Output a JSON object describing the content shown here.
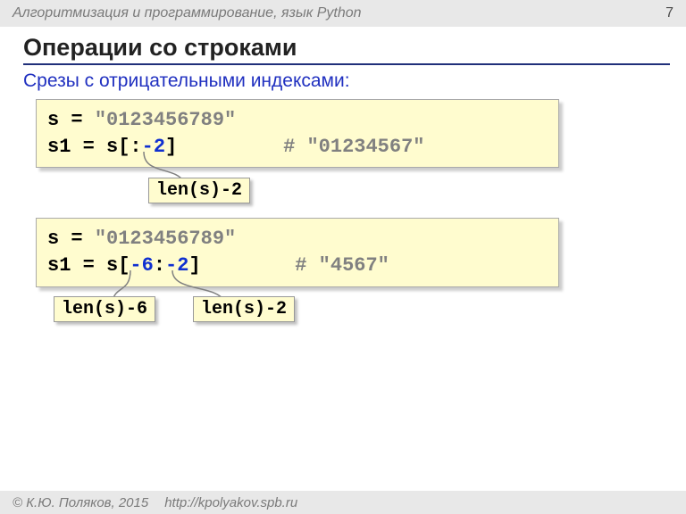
{
  "banner": {
    "course": "Алгоритмизация и программирование, язык Python",
    "page": "7"
  },
  "title": "Операции со строками",
  "subtitle": "Срезы с отрицательными индексами:",
  "block1": {
    "line1_a": "s = ",
    "line1_b": "\"0123456789\"",
    "line2_a": "s1 = s[:",
    "line2_b": "-2",
    "line2_c": "]",
    "pad": "         ",
    "comment": "# \"01234567\"",
    "annot1": "len(s)-2"
  },
  "block2": {
    "line1_a": "s = ",
    "line1_b": "\"0123456789\"",
    "line2_a": "s1 = s[",
    "line2_b": "-6",
    "line2_c": ":",
    "line2_d": "-2",
    "line2_e": "]",
    "pad": "        ",
    "comment": "# \"4567\"",
    "annot1": "len(s)-6",
    "annot2": "len(s)-2"
  },
  "footer": {
    "copy": "© К.Ю. Поляков, 2015",
    "url": "http://kpolyakov.spb.ru"
  }
}
